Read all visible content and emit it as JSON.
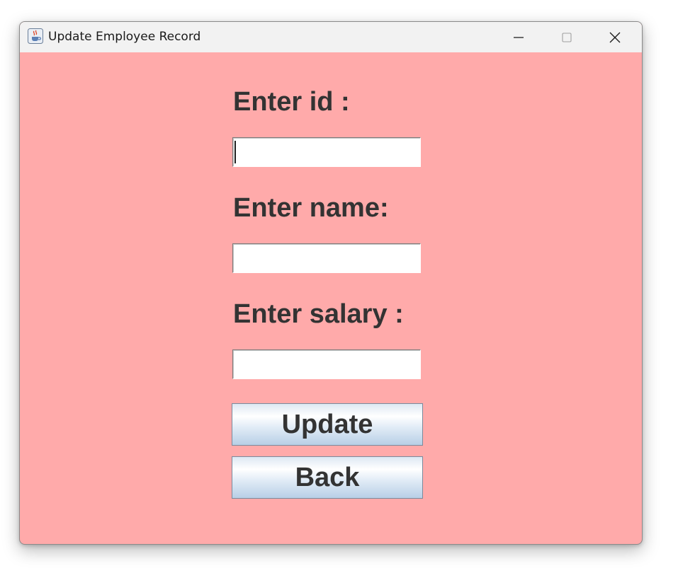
{
  "window": {
    "title": "Update Employee Record",
    "background_color": "#ffaaaa"
  },
  "titlebar": {
    "app_icon": "java-coffee-icon",
    "minimize_icon": "minimize-icon",
    "maximize_icon": "maximize-icon",
    "close_icon": "close-icon"
  },
  "form": {
    "id_label": "Enter id :",
    "id_value": "",
    "name_label": "Enter name:",
    "name_value": "",
    "salary_label": "Enter salary :",
    "salary_value": ""
  },
  "buttons": {
    "update_label": "Update",
    "back_label": "Back"
  }
}
